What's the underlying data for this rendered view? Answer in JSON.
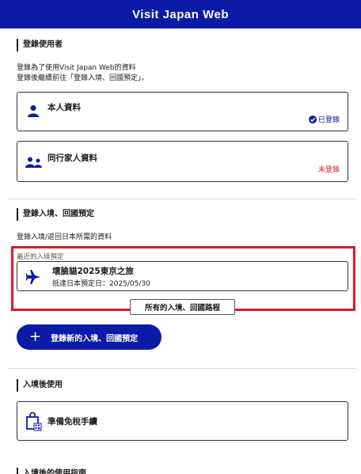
{
  "header": {
    "title": "Visit Japan Web"
  },
  "register_user": {
    "title": "登錄使用者",
    "desc_line1": "登錄為了使用Visit Japan Web的資料",
    "desc_line2": "登錄後繼續前往「登錄入境、回國預定」。",
    "personal": {
      "label": "本人資料",
      "status": "已登錄"
    },
    "companion": {
      "label": "同行家人資料",
      "status": "未登錄"
    }
  },
  "entry": {
    "title": "登錄入境、回國預定",
    "desc": "登錄入境/返回日本所需的資料",
    "recent_label": "最近的入境預定",
    "trip_name": "壞臉貓2025東京之旅",
    "trip_date": "抵達日本預定日：2025/05/30",
    "all_trips": "所有的入境、回國路程",
    "new_button": "登錄新的入境、回國預定"
  },
  "after_entry": {
    "title": "入境後使用",
    "tax_free": "準備免稅手續"
  },
  "guide": {
    "title": "入境後的使用指南"
  },
  "colors": {
    "brand": "#0c1ba6",
    "alert": "#e0182d",
    "highlight": "#e0182d"
  }
}
